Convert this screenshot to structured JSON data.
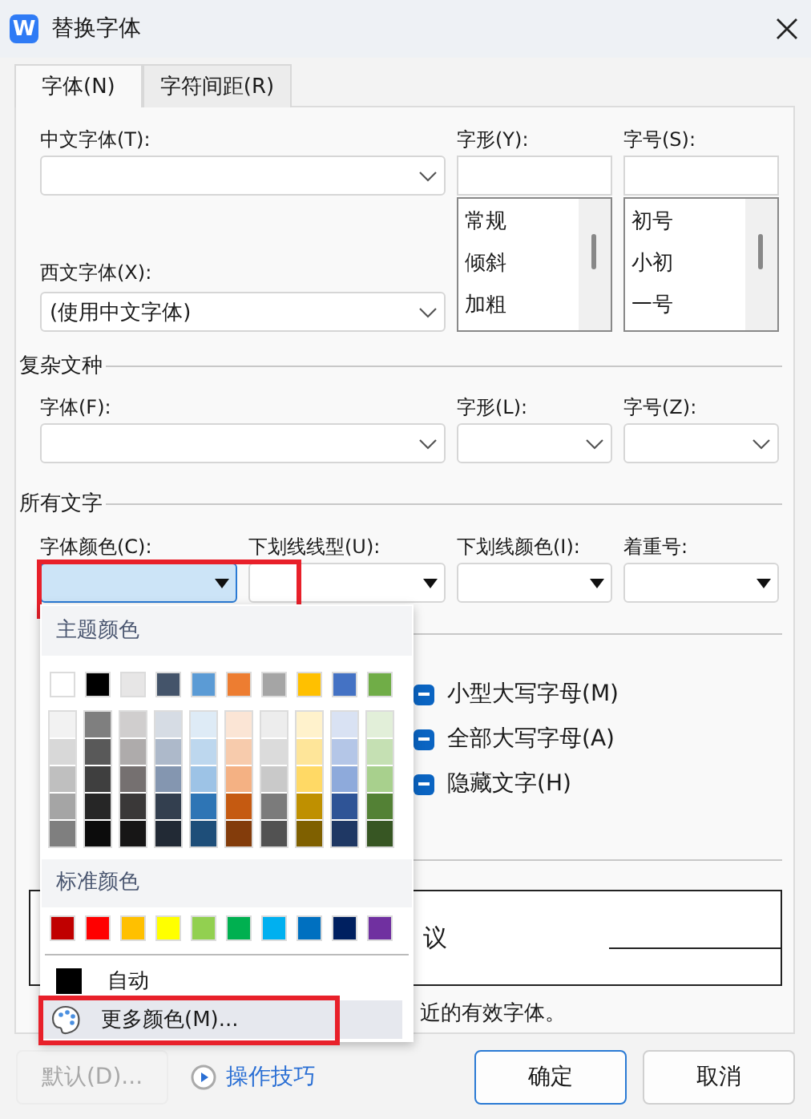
{
  "window": {
    "title": "替换字体",
    "logo_letter": "W"
  },
  "tabs": [
    {
      "label": "字体(N)",
      "selected": true
    },
    {
      "label": "字符间距(R)",
      "selected": false
    }
  ],
  "font": {
    "chinese_font": {
      "label": "中文字体(T):"
    },
    "style": {
      "label": "字形(Y):",
      "options": [
        "常规",
        "倾斜",
        "加粗"
      ]
    },
    "size": {
      "label": "字号(S):",
      "options": [
        "初号",
        "小初",
        "一号"
      ]
    },
    "western_font": {
      "label": "西文字体(X):",
      "value": "(使用中文字体)"
    }
  },
  "complex_script": {
    "title": "复杂文种",
    "fields": [
      {
        "label": "字体(F):"
      },
      {
        "label": "字形(L):"
      },
      {
        "label": "字号(Z):"
      }
    ]
  },
  "all_text": {
    "title": "所有文字",
    "fields": [
      {
        "label": "字体颜色(C):",
        "open": true,
        "highlighted": true
      },
      {
        "label": "下划线线型(U):",
        "open": false,
        "highlighted": false
      },
      {
        "label": "下划线颜色(I):",
        "open": false,
        "highlighted": false
      },
      {
        "label": "着重号:",
        "open": false,
        "highlighted": false
      }
    ]
  },
  "effects": [
    {
      "label": "小型大写字母(M)",
      "indeterminate": true
    },
    {
      "label": "全部大写字母(A)",
      "indeterminate": true
    },
    {
      "label": "隐藏文字(H)",
      "indeterminate": true
    }
  ],
  "preview": {
    "sample": "议",
    "note": "近的有效字体。"
  },
  "color_menu": {
    "theme_title": "主题颜色",
    "theme_colors": [
      {
        "color": "#ffffff"
      },
      {
        "color": "#000000"
      },
      {
        "color": "#e7e6e6"
      },
      {
        "color": "#44546a"
      },
      {
        "color": "#5b9bd5"
      },
      {
        "color": "#ed7d31"
      },
      {
        "color": "#a5a5a5"
      },
      {
        "color": "#ffc000"
      },
      {
        "color": "#4472c4"
      },
      {
        "color": "#70ad47"
      }
    ],
    "shades": [
      [
        {
          "color": "#f2f2f2"
        },
        {
          "color": "#7f7f7f"
        },
        {
          "color": "#d0cece"
        },
        {
          "color": "#d6dce4"
        },
        {
          "color": "#deebf6"
        },
        {
          "color": "#fbe5d5"
        },
        {
          "color": "#ededed"
        },
        {
          "color": "#fff2cc"
        },
        {
          "color": "#d9e2f3"
        },
        {
          "color": "#e2efd9"
        }
      ],
      [
        {
          "color": "#d8d8d8"
        },
        {
          "color": "#595959"
        },
        {
          "color": "#aeabab"
        },
        {
          "color": "#adb9ca"
        },
        {
          "color": "#bdd7ee"
        },
        {
          "color": "#f7cbac"
        },
        {
          "color": "#dbdbdb"
        },
        {
          "color": "#fee599"
        },
        {
          "color": "#b4c6e7"
        },
        {
          "color": "#c5e0b3"
        }
      ],
      [
        {
          "color": "#bfbfbf"
        },
        {
          "color": "#3f3f3f"
        },
        {
          "color": "#757070"
        },
        {
          "color": "#8496b0"
        },
        {
          "color": "#9dc3e6"
        },
        {
          "color": "#f4b183"
        },
        {
          "color": "#c9c9c9"
        },
        {
          "color": "#ffd965"
        },
        {
          "color": "#8eaadb"
        },
        {
          "color": "#a8d08d"
        }
      ],
      [
        {
          "color": "#a5a5a5"
        },
        {
          "color": "#262626"
        },
        {
          "color": "#3a3838"
        },
        {
          "color": "#333f4f"
        },
        {
          "color": "#2e75b5"
        },
        {
          "color": "#c55a11"
        },
        {
          "color": "#7b7b7b"
        },
        {
          "color": "#bf9000"
        },
        {
          "color": "#2f5496"
        },
        {
          "color": "#538135"
        }
      ],
      [
        {
          "color": "#7f7f7f"
        },
        {
          "color": "#0c0c0c"
        },
        {
          "color": "#171616"
        },
        {
          "color": "#222a35"
        },
        {
          "color": "#1e4e79"
        },
        {
          "color": "#833c0b"
        },
        {
          "color": "#525252"
        },
        {
          "color": "#7f6000"
        },
        {
          "color": "#1f3864"
        },
        {
          "color": "#375623"
        }
      ]
    ],
    "standard_title": "标准颜色",
    "standard_colors": [
      {
        "color": "#c00000"
      },
      {
        "color": "#ff0000"
      },
      {
        "color": "#ffc000"
      },
      {
        "color": "#ffff00"
      },
      {
        "color": "#92d050"
      },
      {
        "color": "#00b050"
      },
      {
        "color": "#00b0f0"
      },
      {
        "color": "#0070c0"
      },
      {
        "color": "#002060"
      },
      {
        "color": "#7030a0"
      }
    ],
    "items": [
      {
        "kind": "swatch",
        "label": "自动",
        "color": "#000000",
        "hovered": false,
        "highlighted": false
      },
      {
        "kind": "palette",
        "label": "更多颜色(M)...",
        "hovered": true,
        "highlighted": true
      }
    ]
  },
  "buttons": [
    {
      "kind": "plain",
      "label": "默认(D)...",
      "disabled": true
    },
    {
      "kind": "link",
      "label": "操作技巧",
      "disabled": false
    },
    {
      "kind": "default",
      "label": "确定",
      "disabled": false
    },
    {
      "kind": "plain",
      "label": "取消",
      "disabled": false
    }
  ]
}
